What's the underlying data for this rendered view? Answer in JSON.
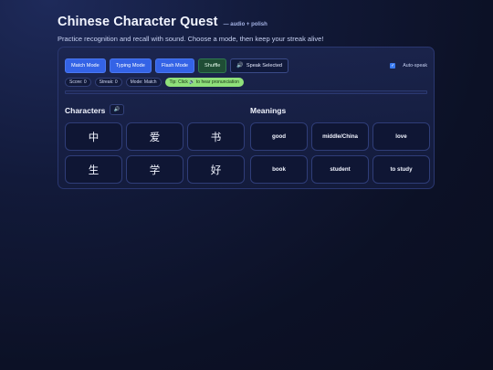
{
  "header": {
    "title": "Chinese Character Quest",
    "title_suffix": "— audio + polish",
    "subtitle": "Practice recognition and recall with sound. Choose a mode, then keep your streak alive!"
  },
  "toolbar": {
    "match_mode": "Match Mode",
    "typing_mode": "Typing Mode",
    "flash_mode": "Flash Mode",
    "shuffle": "Shuffle",
    "speak_icon": "🔊",
    "speak_selected": "Speak Selected",
    "auto_speak_label": "Auto-speak",
    "auto_speak_checked": true
  },
  "status": {
    "score": "Score: 0",
    "streak": "Streak: 0",
    "mode": "Mode: Match",
    "tip": "Tip: Click 🔊 to hear pronunciation"
  },
  "progress": {
    "value": 0
  },
  "characters": {
    "heading": "Characters",
    "speak_icon": "🔊",
    "items": [
      "中",
      "爱",
      "书",
      "生",
      "学",
      "好"
    ]
  },
  "meanings": {
    "heading": "Meanings",
    "items": [
      "good",
      "middle/China",
      "love",
      "book",
      "student",
      "to study"
    ]
  },
  "colors": {
    "accent": "#3463e6",
    "shuffle_bg": "#1f4d35",
    "tip_bg": "#8fe07a",
    "card_bg": "#18224a"
  }
}
